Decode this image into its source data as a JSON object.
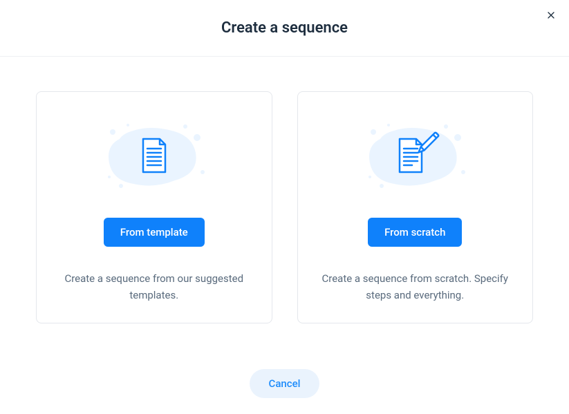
{
  "modal": {
    "title": "Create a sequence",
    "cards": {
      "template": {
        "button_label": "From template",
        "description": "Create a sequence from our suggested templates."
      },
      "scratch": {
        "button_label": "From scratch",
        "description": "Create a sequence from scratch. Specify steps and everything."
      }
    },
    "cancel_label": "Cancel"
  }
}
